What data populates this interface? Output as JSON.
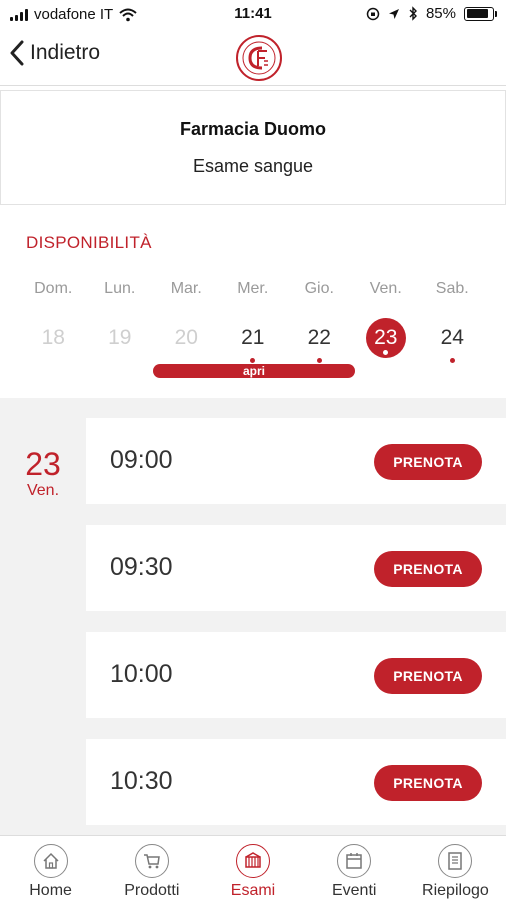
{
  "status_bar": {
    "carrier": "vodafone IT",
    "time": "11:41",
    "battery": "85%",
    "battery_level": 0.85
  },
  "nav": {
    "back_label": "Indietro",
    "logo_icon": "pharmacy-logo-icon"
  },
  "header": {
    "pharmacy_name": "Farmacia Duomo",
    "exam_name": "Esame sangue"
  },
  "availability": {
    "title": "DISPONIBILITÀ",
    "month_label": "apri",
    "days": [
      {
        "name": "Dom.",
        "num": "18",
        "state": "disabled"
      },
      {
        "name": "Lun.",
        "num": "19",
        "state": "disabled"
      },
      {
        "name": "Mar.",
        "num": "20",
        "state": "disabled"
      },
      {
        "name": "Mer.",
        "num": "21",
        "state": "available"
      },
      {
        "name": "Gio.",
        "num": "22",
        "state": "available"
      },
      {
        "name": "Ven.",
        "num": "23",
        "state": "selected"
      },
      {
        "name": "Sab.",
        "num": "24",
        "state": "available"
      }
    ]
  },
  "slots": {
    "date_num": "23",
    "date_day": "Ven.",
    "book_label": "PRENOTA",
    "times": [
      "09:00",
      "09:30",
      "10:00",
      "10:30"
    ]
  },
  "tabs": [
    {
      "label": "Home",
      "icon": "home-icon",
      "active": false
    },
    {
      "label": "Prodotti",
      "icon": "cart-icon",
      "active": false
    },
    {
      "label": "Esami",
      "icon": "exams-icon",
      "active": true
    },
    {
      "label": "Eventi",
      "icon": "calendar-icon",
      "active": false
    },
    {
      "label": "Riepilogo",
      "icon": "summary-icon",
      "active": false
    }
  ],
  "colors": {
    "accent": "#c0222b",
    "muted": "#9a9a9a",
    "background": "#f2f2f2"
  }
}
